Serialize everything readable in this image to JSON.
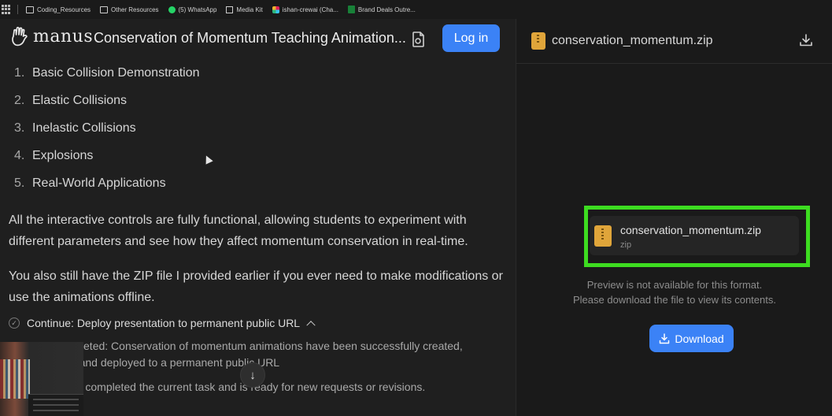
{
  "bookmarks": [
    {
      "icon": "folder-icon",
      "label": "Coding_Resources"
    },
    {
      "icon": "folder-icon",
      "label": "Other Resources"
    },
    {
      "icon": "whatsapp-icon",
      "label": "(5) WhatsApp"
    },
    {
      "icon": "media-icon",
      "label": "Media Kit"
    },
    {
      "icon": "slack-icon",
      "label": "ishan-crewai (Cha..."
    },
    {
      "icon": "sheets-icon",
      "label": "Brand Deals Outre..."
    }
  ],
  "header": {
    "logo_text": "manus",
    "title": "Conservation of Momentum Teaching Animation...",
    "login_label": "Log in"
  },
  "sections": [
    {
      "num": "1.",
      "label": "Basic Collision Demonstration"
    },
    {
      "num": "2.",
      "label": "Elastic Collisions"
    },
    {
      "num": "3.",
      "label": "Inelastic Collisions"
    },
    {
      "num": "4.",
      "label": "Explosions"
    },
    {
      "num": "5.",
      "label": "Real-World Applications"
    }
  ],
  "paragraphs": {
    "p1": "All the interactive controls are fully functional, allowing students to experiment with different parameters and see how they affect momentum conservation in real-time.",
    "p2": "You also still have the ZIP file I provided earlier if you ever need to make modifications or use the animations offline."
  },
  "task": {
    "continue_label": "Continue: Deploy presentation to permanent public URL",
    "completed": "Task completed: Conservation of momentum animations have been successfully created, delivered, and deployed to a permanent public URL",
    "ready": "Manus has completed the current task and is ready for new requests or revisions."
  },
  "scroll_down_glyph": "↓",
  "preview": {
    "header_filename": "conservation_momentum.zip",
    "card_filename": "conservation_momentum.zip",
    "card_ext": "zip",
    "message_line1": "Preview is not available for this format.",
    "message_line2": "Please download the file to view its contents.",
    "download_label": "Download"
  },
  "colors": {
    "accent": "#3b82f6",
    "highlight": "#3ddc20",
    "zip": "#e0a53a"
  }
}
